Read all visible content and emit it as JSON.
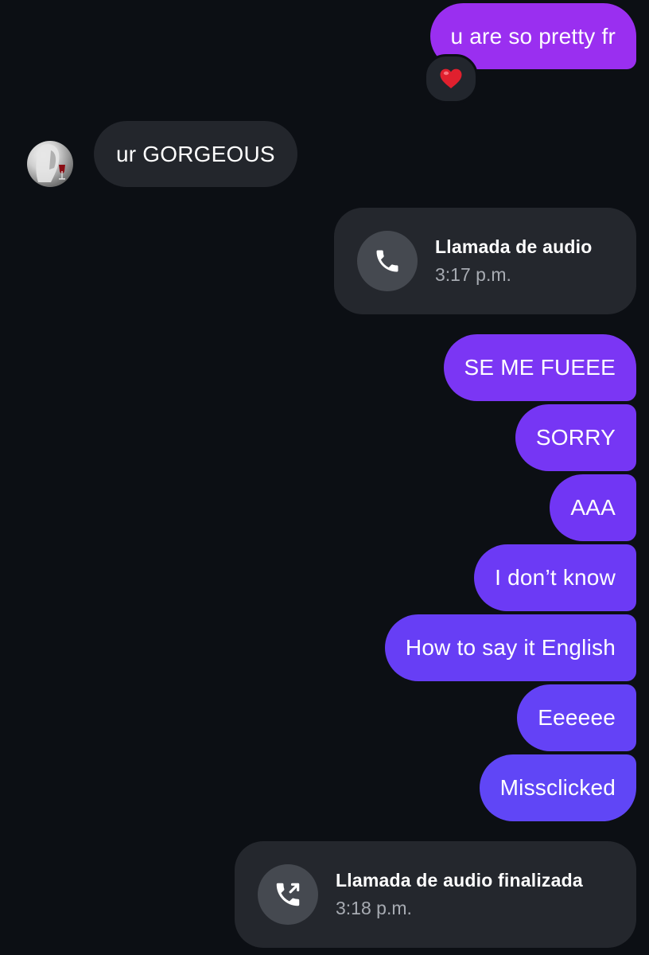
{
  "thread": {
    "sent_first": {
      "text": "u are so pretty fr",
      "reaction": "❤️",
      "color": "#9a2ff0"
    },
    "received": {
      "text": "ur GORGEOUS",
      "avatar": "contact-avatar",
      "color": "#23262c"
    },
    "call_start": {
      "title": "Llamada de audio",
      "time": "3:17 p.m.",
      "icon": "phone-icon"
    },
    "burst": [
      {
        "text": "SE ME FUEEE",
        "color": "#7b36f4"
      },
      {
        "text": "SORRY",
        "color": "#7636f4"
      },
      {
        "text": "AAA",
        "color": "#7136f4"
      },
      {
        "text": "I don’t know",
        "color": "#6c3af5"
      },
      {
        "text": "How to say it English",
        "color": "#673ef5"
      },
      {
        "text": "Eeeeee",
        "color": "#6442f6"
      },
      {
        "text": "Missclicked",
        "color": "#6046f6"
      }
    ],
    "call_end": {
      "title": "Llamada de audio finalizada",
      "time": "3:18 p.m.",
      "icon": "phone-outgoing-icon"
    }
  },
  "colors": {
    "background": "#0c0f14",
    "incoming_bubble": "#23262c",
    "call_card": "#24272d",
    "call_icon_circle": "#454950",
    "secondary_text": "#a7abb2"
  }
}
